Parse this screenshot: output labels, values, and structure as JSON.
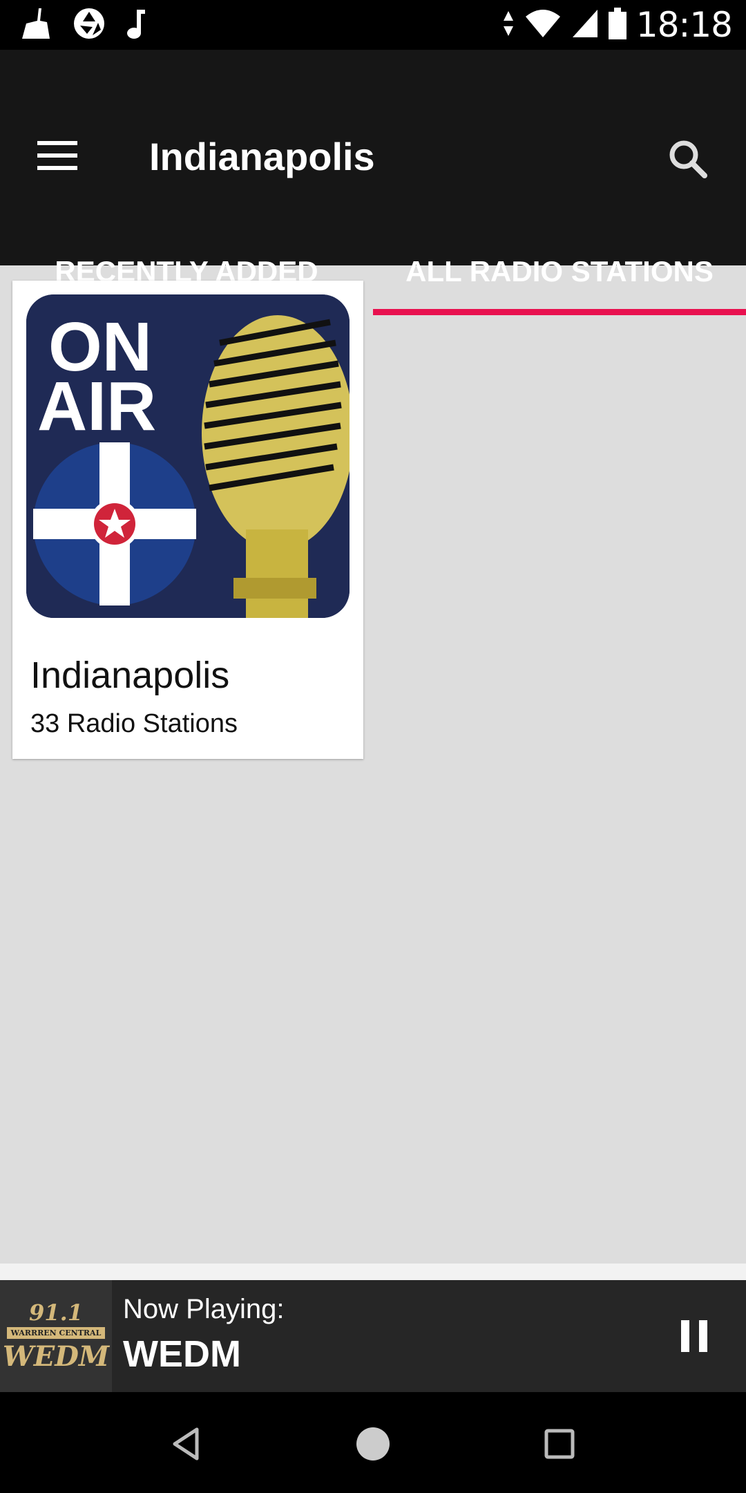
{
  "status_bar": {
    "time": "18:18",
    "left_icons": [
      "cleaner-icon",
      "aperture-icon",
      "music-note-icon"
    ],
    "right_icons": [
      "data-arrows-icon",
      "wifi-icon",
      "signal-icon",
      "battery-icon"
    ]
  },
  "app_bar": {
    "title": "Indianapolis",
    "menu_icon": "hamburger-menu-icon",
    "search_icon": "search-icon"
  },
  "tabs": [
    {
      "label": "RECENTLY ADDED",
      "active": false
    },
    {
      "label": "ALL RADIO STATIONS",
      "active": true
    }
  ],
  "accent_color": "#e8114f",
  "cards": [
    {
      "image_text_line1": "ON",
      "image_text_line2": "AIR",
      "title": "Indianapolis",
      "subtitle": "33 Radio Stations"
    }
  ],
  "now_playing": {
    "label": "Now Playing:",
    "station": "WEDM",
    "art_freq": "91.1",
    "art_banner": "WARRREN CENTRAL",
    "art_call": "WEDM",
    "control_icon": "pause-icon"
  },
  "nav_bar": {
    "buttons": [
      "back-icon",
      "home-icon",
      "recents-icon"
    ]
  }
}
